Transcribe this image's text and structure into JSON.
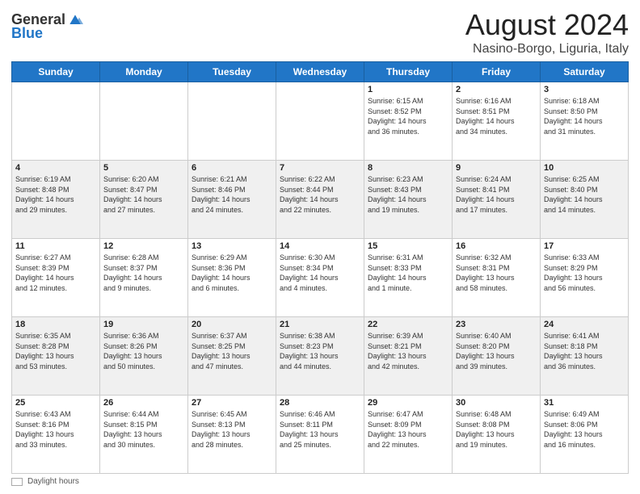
{
  "header": {
    "logo_general": "General",
    "logo_blue": "Blue",
    "month_title": "August 2024",
    "location": "Nasino-Borgo, Liguria, Italy"
  },
  "weekdays": [
    "Sunday",
    "Monday",
    "Tuesday",
    "Wednesday",
    "Thursday",
    "Friday",
    "Saturday"
  ],
  "footer": {
    "daylight_label": "Daylight hours"
  },
  "weeks": [
    [
      {
        "day": "",
        "info": ""
      },
      {
        "day": "",
        "info": ""
      },
      {
        "day": "",
        "info": ""
      },
      {
        "day": "",
        "info": ""
      },
      {
        "day": "1",
        "info": "Sunrise: 6:15 AM\nSunset: 8:52 PM\nDaylight: 14 hours\nand 36 minutes."
      },
      {
        "day": "2",
        "info": "Sunrise: 6:16 AM\nSunset: 8:51 PM\nDaylight: 14 hours\nand 34 minutes."
      },
      {
        "day": "3",
        "info": "Sunrise: 6:18 AM\nSunset: 8:50 PM\nDaylight: 14 hours\nand 31 minutes."
      }
    ],
    [
      {
        "day": "4",
        "info": "Sunrise: 6:19 AM\nSunset: 8:48 PM\nDaylight: 14 hours\nand 29 minutes."
      },
      {
        "day": "5",
        "info": "Sunrise: 6:20 AM\nSunset: 8:47 PM\nDaylight: 14 hours\nand 27 minutes."
      },
      {
        "day": "6",
        "info": "Sunrise: 6:21 AM\nSunset: 8:46 PM\nDaylight: 14 hours\nand 24 minutes."
      },
      {
        "day": "7",
        "info": "Sunrise: 6:22 AM\nSunset: 8:44 PM\nDaylight: 14 hours\nand 22 minutes."
      },
      {
        "day": "8",
        "info": "Sunrise: 6:23 AM\nSunset: 8:43 PM\nDaylight: 14 hours\nand 19 minutes."
      },
      {
        "day": "9",
        "info": "Sunrise: 6:24 AM\nSunset: 8:41 PM\nDaylight: 14 hours\nand 17 minutes."
      },
      {
        "day": "10",
        "info": "Sunrise: 6:25 AM\nSunset: 8:40 PM\nDaylight: 14 hours\nand 14 minutes."
      }
    ],
    [
      {
        "day": "11",
        "info": "Sunrise: 6:27 AM\nSunset: 8:39 PM\nDaylight: 14 hours\nand 12 minutes."
      },
      {
        "day": "12",
        "info": "Sunrise: 6:28 AM\nSunset: 8:37 PM\nDaylight: 14 hours\nand 9 minutes."
      },
      {
        "day": "13",
        "info": "Sunrise: 6:29 AM\nSunset: 8:36 PM\nDaylight: 14 hours\nand 6 minutes."
      },
      {
        "day": "14",
        "info": "Sunrise: 6:30 AM\nSunset: 8:34 PM\nDaylight: 14 hours\nand 4 minutes."
      },
      {
        "day": "15",
        "info": "Sunrise: 6:31 AM\nSunset: 8:33 PM\nDaylight: 14 hours\nand 1 minute."
      },
      {
        "day": "16",
        "info": "Sunrise: 6:32 AM\nSunset: 8:31 PM\nDaylight: 13 hours\nand 58 minutes."
      },
      {
        "day": "17",
        "info": "Sunrise: 6:33 AM\nSunset: 8:29 PM\nDaylight: 13 hours\nand 56 minutes."
      }
    ],
    [
      {
        "day": "18",
        "info": "Sunrise: 6:35 AM\nSunset: 8:28 PM\nDaylight: 13 hours\nand 53 minutes."
      },
      {
        "day": "19",
        "info": "Sunrise: 6:36 AM\nSunset: 8:26 PM\nDaylight: 13 hours\nand 50 minutes."
      },
      {
        "day": "20",
        "info": "Sunrise: 6:37 AM\nSunset: 8:25 PM\nDaylight: 13 hours\nand 47 minutes."
      },
      {
        "day": "21",
        "info": "Sunrise: 6:38 AM\nSunset: 8:23 PM\nDaylight: 13 hours\nand 44 minutes."
      },
      {
        "day": "22",
        "info": "Sunrise: 6:39 AM\nSunset: 8:21 PM\nDaylight: 13 hours\nand 42 minutes."
      },
      {
        "day": "23",
        "info": "Sunrise: 6:40 AM\nSunset: 8:20 PM\nDaylight: 13 hours\nand 39 minutes."
      },
      {
        "day": "24",
        "info": "Sunrise: 6:41 AM\nSunset: 8:18 PM\nDaylight: 13 hours\nand 36 minutes."
      }
    ],
    [
      {
        "day": "25",
        "info": "Sunrise: 6:43 AM\nSunset: 8:16 PM\nDaylight: 13 hours\nand 33 minutes."
      },
      {
        "day": "26",
        "info": "Sunrise: 6:44 AM\nSunset: 8:15 PM\nDaylight: 13 hours\nand 30 minutes."
      },
      {
        "day": "27",
        "info": "Sunrise: 6:45 AM\nSunset: 8:13 PM\nDaylight: 13 hours\nand 28 minutes."
      },
      {
        "day": "28",
        "info": "Sunrise: 6:46 AM\nSunset: 8:11 PM\nDaylight: 13 hours\nand 25 minutes."
      },
      {
        "day": "29",
        "info": "Sunrise: 6:47 AM\nSunset: 8:09 PM\nDaylight: 13 hours\nand 22 minutes."
      },
      {
        "day": "30",
        "info": "Sunrise: 6:48 AM\nSunset: 8:08 PM\nDaylight: 13 hours\nand 19 minutes."
      },
      {
        "day": "31",
        "info": "Sunrise: 6:49 AM\nSunset: 8:06 PM\nDaylight: 13 hours\nand 16 minutes."
      }
    ]
  ]
}
